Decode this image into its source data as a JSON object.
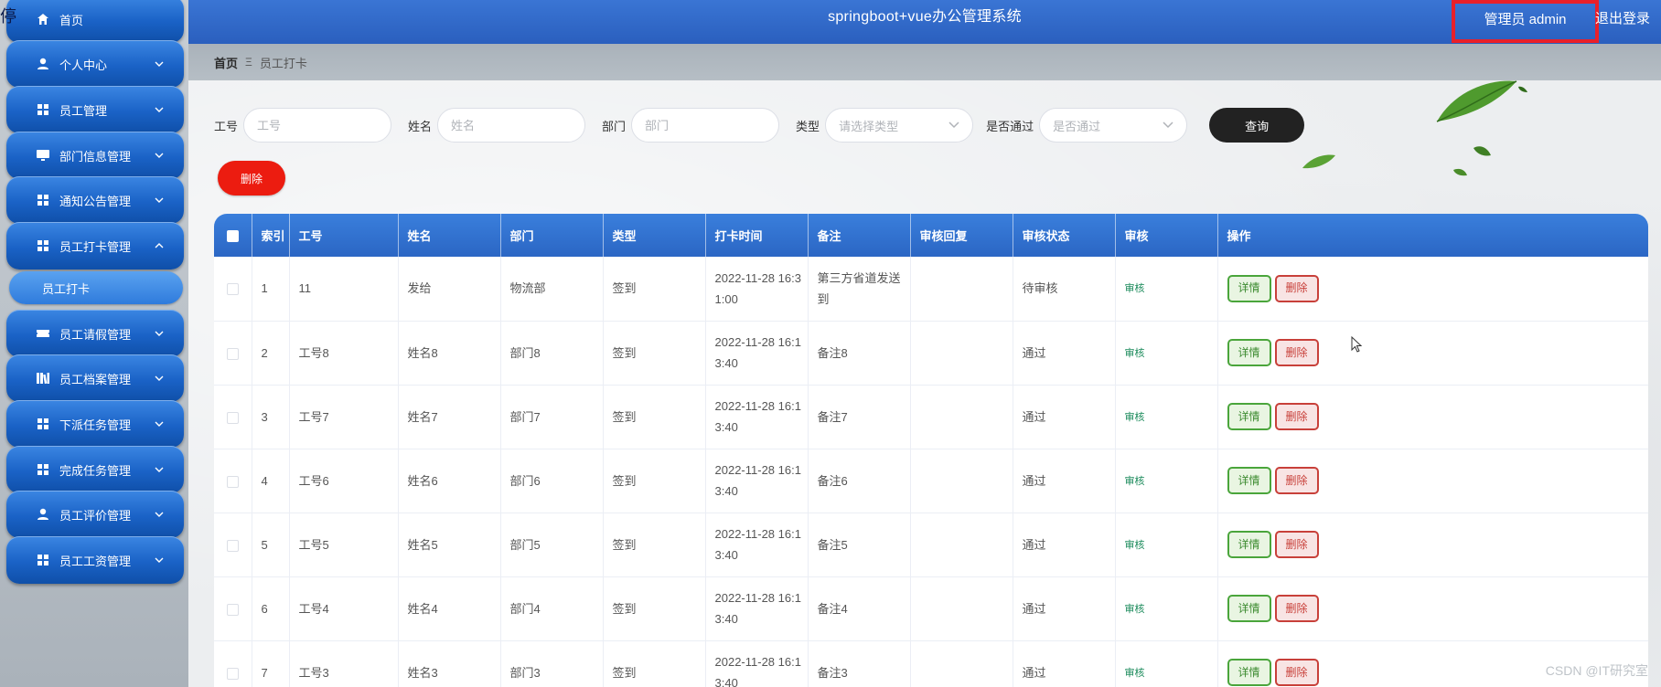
{
  "header": {
    "title": "springboot+vue办公管理系统",
    "admin": "管理员 admin",
    "logout": "退出登录",
    "highlight_color": "#e8202a"
  },
  "sidebar": {
    "items": [
      {
        "label": "首页",
        "icon": "home-icon",
        "expandable": false
      },
      {
        "label": "个人中心",
        "icon": "user-icon",
        "expandable": true
      },
      {
        "label": "员工管理",
        "icon": "grid-icon",
        "expandable": true
      },
      {
        "label": "部门信息管理",
        "icon": "monitor-icon",
        "expandable": true
      },
      {
        "label": "通知公告管理",
        "icon": "grid-icon",
        "expandable": true
      },
      {
        "label": "员工打卡管理",
        "icon": "grid-icon",
        "expandable": true,
        "expanded": true
      },
      {
        "label": "员工请假管理",
        "icon": "ticket-icon",
        "expandable": true
      },
      {
        "label": "员工档案管理",
        "icon": "books-icon",
        "expandable": true
      },
      {
        "label": "下派任务管理",
        "icon": "grid-icon",
        "expandable": true
      },
      {
        "label": "完成任务管理",
        "icon": "grid-icon",
        "expandable": true
      },
      {
        "label": "员工评价管理",
        "icon": "user-icon",
        "expandable": true
      },
      {
        "label": "员工工资管理",
        "icon": "grid-icon",
        "expandable": true
      }
    ],
    "sub_item": "员工打卡"
  },
  "breadcrumb": {
    "home": "首页",
    "separator": "Ξ",
    "current": "员工打卡"
  },
  "search": {
    "employee_no_label": "工号",
    "employee_no_placeholder": "工号",
    "name_label": "姓名",
    "name_placeholder": "姓名",
    "dept_label": "部门",
    "dept_placeholder": "部门",
    "type_label": "类型",
    "type_placeholder": "请选择类型",
    "passed_label": "是否通过",
    "passed_placeholder": "是否通过",
    "query_button": "查询"
  },
  "actions": {
    "delete_button": "删除"
  },
  "table": {
    "columns": [
      "索引",
      "工号",
      "姓名",
      "部门",
      "类型",
      "打卡时间",
      "备注",
      "审核回复",
      "审核状态",
      "审核",
      "操作"
    ],
    "rows": [
      {
        "index": "1",
        "no": "11",
        "name": "发给",
        "dept": "物流部",
        "type": "签到",
        "time1": "2022-11-28 16:3",
        "time2": "1:00",
        "remark": "第三方省道发送到",
        "reply": "",
        "status": "待审核",
        "audit": "审核",
        "detail": "详情",
        "del": "删除"
      },
      {
        "index": "2",
        "no": "工号8",
        "name": "姓名8",
        "dept": "部门8",
        "type": "签到",
        "time1": "2022-11-28 16:1",
        "time2": "3:40",
        "remark": "备注8",
        "reply": "",
        "status": "通过",
        "audit": "审核",
        "detail": "详情",
        "del": "删除"
      },
      {
        "index": "3",
        "no": "工号7",
        "name": "姓名7",
        "dept": "部门7",
        "type": "签到",
        "time1": "2022-11-28 16:1",
        "time2": "3:40",
        "remark": "备注7",
        "reply": "",
        "status": "通过",
        "audit": "审核",
        "detail": "详情",
        "del": "删除"
      },
      {
        "index": "4",
        "no": "工号6",
        "name": "姓名6",
        "dept": "部门6",
        "type": "签到",
        "time1": "2022-11-28 16:1",
        "time2": "3:40",
        "remark": "备注6",
        "reply": "",
        "status": "通过",
        "audit": "审核",
        "detail": "详情",
        "del": "删除"
      },
      {
        "index": "5",
        "no": "工号5",
        "name": "姓名5",
        "dept": "部门5",
        "type": "签到",
        "time1": "2022-11-28 16:1",
        "time2": "3:40",
        "remark": "备注5",
        "reply": "",
        "status": "通过",
        "audit": "审核",
        "detail": "详情",
        "del": "删除"
      },
      {
        "index": "6",
        "no": "工号4",
        "name": "姓名4",
        "dept": "部门4",
        "type": "签到",
        "time1": "2022-11-28 16:1",
        "time2": "3:40",
        "remark": "备注4",
        "reply": "",
        "status": "通过",
        "audit": "审核",
        "detail": "详情",
        "del": "删除"
      },
      {
        "index": "7",
        "no": "工号3",
        "name": "姓名3",
        "dept": "部门3",
        "type": "签到",
        "time1": "2022-11-28 16:1",
        "time2": "3:40",
        "remark": "备注3",
        "reply": "",
        "status": "通过",
        "audit": "审核",
        "detail": "详情",
        "del": "删除"
      }
    ]
  },
  "watermark": "CSDN @IT研究室",
  "colors": {
    "header_blue": "#2a5fbe",
    "nav_blue": "#1a62c6",
    "delete_red": "#ec1c10",
    "query_black": "#222222",
    "detail_green": "#4aa53b",
    "delete_border": "#c8403a"
  }
}
